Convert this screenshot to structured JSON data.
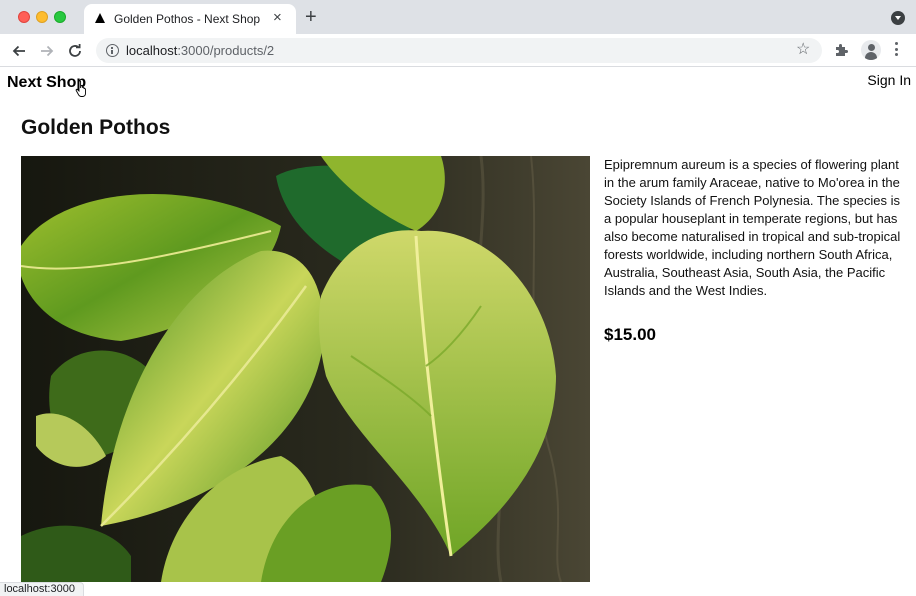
{
  "browser": {
    "tab_title": "Golden Pothos - Next Shop",
    "tab_close": "×",
    "new_tab": "+",
    "url_host": "localhost",
    "url_path": ":3000/products/2",
    "status_url": "localhost:3000"
  },
  "icons": {
    "back": "back-arrow-icon",
    "forward": "forward-arrow-icon",
    "reload": "reload-icon",
    "info": "info-icon",
    "bookmark": "star-icon",
    "extensions": "puzzle-icon",
    "profile": "profile-icon",
    "menu": "kebab-menu-icon",
    "cursor": "hand-pointer-icon"
  },
  "header": {
    "brand": "Next Shop",
    "sign_in": "Sign In"
  },
  "product": {
    "title": "Golden Pothos",
    "description": "Epipremnum aureum is a species of flowering plant in the arum family Araceae, native to Mo'orea in the Society Islands of French Polynesia. The species is a popular houseplant in temperate regions, but has also become naturalised in tropical and sub-tropical forests worldwide, including northern South Africa, Australia, Southeast Asia, South Asia, the Pacific Islands and the West Indies.",
    "price": "$15.00"
  },
  "colors": {
    "leaf_green": "#3f8a1c",
    "leaf_yellow": "#c9d65a",
    "background_dark": "#1c1d14"
  }
}
